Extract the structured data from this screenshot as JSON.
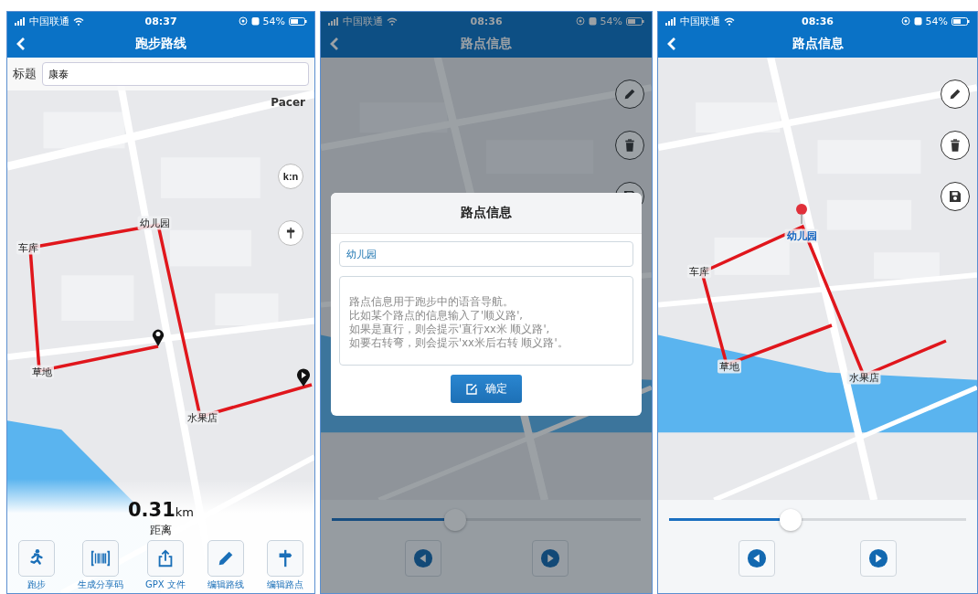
{
  "panels": [
    {
      "kind": "route",
      "status_bar": {
        "carrier": "中国联通",
        "time": "08:37",
        "battery": "54%"
      },
      "title": "跑步路线",
      "title_field": {
        "label": "标题",
        "value": "康泰"
      },
      "map_brand": "Pacer",
      "map_controls": [
        {
          "kind": "text",
          "label": "k:n"
        },
        {
          "kind": "signpost"
        }
      ],
      "waypoints": [
        {
          "name": "幼儿园",
          "selected": false
        },
        {
          "name": "车库",
          "selected": false
        },
        {
          "name": "草地",
          "selected": false
        },
        {
          "name": "水果店",
          "selected": false
        }
      ],
      "distance": {
        "value": "0.31",
        "unit": "km",
        "label": "距离"
      },
      "actions": [
        {
          "kind": "run",
          "label": "跑步"
        },
        {
          "kind": "barcode",
          "label": "生成分享码"
        },
        {
          "kind": "share",
          "label": "GPX 文件"
        },
        {
          "kind": "edit",
          "label": "编辑路线"
        },
        {
          "kind": "signpost",
          "label": "编辑路点"
        }
      ]
    },
    {
      "kind": "dialog",
      "status_bar": {
        "carrier": "中国联通",
        "time": "08:36",
        "battery": "54%"
      },
      "title": "路点信息",
      "side_buttons": [
        {
          "kind": "edit"
        },
        {
          "kind": "delete"
        },
        {
          "kind": "save"
        }
      ],
      "slider": {
        "level": 0.4
      },
      "steps": [
        {
          "kind": "previous"
        },
        {
          "kind": "next"
        }
      ],
      "dialog": {
        "title": "路点信息",
        "name_field": {
          "value": "幼儿园"
        },
        "note_field": {
          "placeholder_lines": [
            "路点信息用于跑步中的语音导航。",
            "比如某个路点的信息输入了'顺义路',",
            "如果是直行，则会提示'直行xx米 顺义路',",
            "如要右转弯，则会提示'xx米后右转 顺义路'。"
          ]
        },
        "confirm_button": "确定"
      }
    },
    {
      "kind": "waypoint",
      "status_bar": {
        "carrier": "中国联通",
        "time": "08:36",
        "battery": "54%"
      },
      "title": "路点信息",
      "side_buttons": [
        {
          "kind": "edit"
        },
        {
          "kind": "delete"
        },
        {
          "kind": "save"
        }
      ],
      "waypoints": [
        {
          "name": "幼儿园",
          "selected": true
        },
        {
          "name": "车库",
          "selected": false
        },
        {
          "name": "草地",
          "selected": false
        },
        {
          "name": "水果店",
          "selected": false
        }
      ],
      "slider": {
        "level": 0.41
      },
      "steps": [
        {
          "kind": "previous"
        },
        {
          "kind": "next"
        }
      ]
    }
  ]
}
